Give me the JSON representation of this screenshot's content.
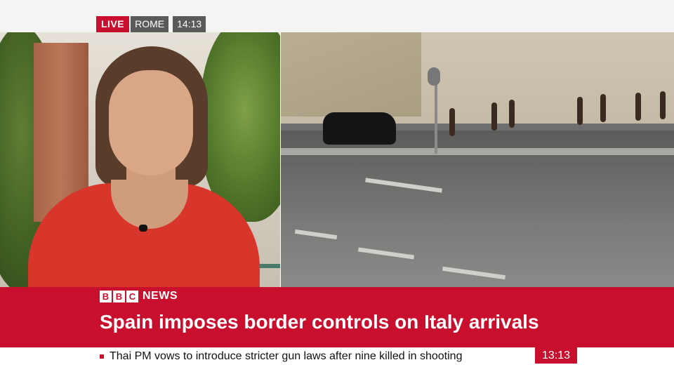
{
  "top": {
    "live_label": "LIVE",
    "location": "ROME",
    "time": "14:13"
  },
  "brand": {
    "letters": [
      "B",
      "B",
      "C"
    ],
    "news_label": "NEWS"
  },
  "headline": "Spain imposes border controls on Italy arrivals",
  "ticker": {
    "text": "Thai PM vows to introduce stricter gun laws after nine killed in shooting",
    "clock": "13:13"
  },
  "colors": {
    "brand_red": "#c8102e",
    "badge_gray": "#5a5a5a",
    "shirt_red": "#d9362b"
  }
}
